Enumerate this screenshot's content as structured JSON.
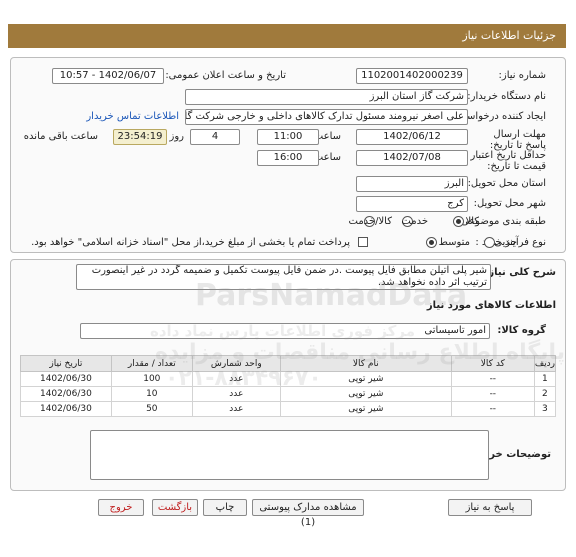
{
  "header": {
    "title": "جزئیات اطلاعات نیاز"
  },
  "form": {
    "need_number_label": "شماره نیاز:",
    "need_number": "1102001402000239",
    "announce_label": "تاریخ و ساعت اعلان عمومی:",
    "announce_value": "1402/06/07 - 10:57",
    "buyer_label": "نام دستگاه خریدار:",
    "buyer_value": "شرکت گاز استان البرز",
    "creator_label": "ایجاد کننده درخواست:",
    "creator_value": "علی اصغر نیرومند مسئول تدارک کالاهای داخلی و خارجی شرکت گاز استان البرز",
    "contact_link": "اطلاعات تماس خریدار",
    "deadline_label": "مهلت ارسال پاسخ تا تاریخ:",
    "deadline_date": "1402/06/12",
    "time_label": "ساعت",
    "deadline_time": "11:00",
    "days_value": "4",
    "days_label": "روز و",
    "remaining_time": "23:54:19",
    "remaining_label": "ساعت باقی مانده",
    "validity_label": "حداقل تاریخ اعتبار قیمت تا تاریخ:",
    "validity_date": "1402/07/08",
    "validity_time": "16:00",
    "province_label": "استان محل تحویل:",
    "province_value": "البرز",
    "city_label": "شهر محل تحویل:",
    "city_value": "کرج",
    "category_label": "طبقه بندی موضوعی:",
    "category_options": [
      "کالا",
      "خدمت",
      "کالا/خدمت"
    ],
    "process_label": "نوع فرآیند خرید :",
    "process_options": [
      "جزیی",
      "متوسط"
    ],
    "payment_note": "پرداخت تمام یا بخشی از مبلغ خرید،از محل \"اسناد خزانه اسلامی\" خواهد بود."
  },
  "description": {
    "label": "شرح کلی نیاز:",
    "text": "شیر پلی اتیلن مطابق فایل پیوست .در ضمن فایل پیوست تکمیل و ضمیمه گردد در غیر اینصورت ترتیب اثر داده نخواهد شد."
  },
  "goods": {
    "section_title": "اطلاعات کالاهای مورد نیاز",
    "group_label": "گروه کالا:",
    "group_value": "امور تاسیساتی",
    "columns": [
      "ردیف",
      "کد کالا",
      "نام کالا",
      "واحد شمارش",
      "تعداد / مقدار",
      "تاریخ نیاز"
    ],
    "rows": [
      [
        "1",
        "--",
        "شیر توپی",
        "عدد",
        "100",
        "1402/06/30"
      ],
      [
        "2",
        "--",
        "شیر توپی",
        "عدد",
        "10",
        "1402/06/30"
      ],
      [
        "3",
        "--",
        "شیر توپی",
        "عدد",
        "50",
        "1402/06/30"
      ]
    ]
  },
  "buyer_notes": {
    "label": "توضیحات خریدار:",
    "value": ""
  },
  "buttons": {
    "reply": "پاسخ به نیاز",
    "attachments": "مشاهده مدارک پیوستی (1)",
    "print": "چاپ",
    "back": "بازگشت",
    "exit": "خروج"
  },
  "watermark": {
    "brand": "ParsNamadData",
    "line1": "مرکز فوری اطلاعات پارس نماد داده",
    "line2": "پایگاه اطلاع رسانی مناقصات و مزایده",
    "phone": "۰۲۱-۸۸۳۴۹۶۷۰"
  }
}
